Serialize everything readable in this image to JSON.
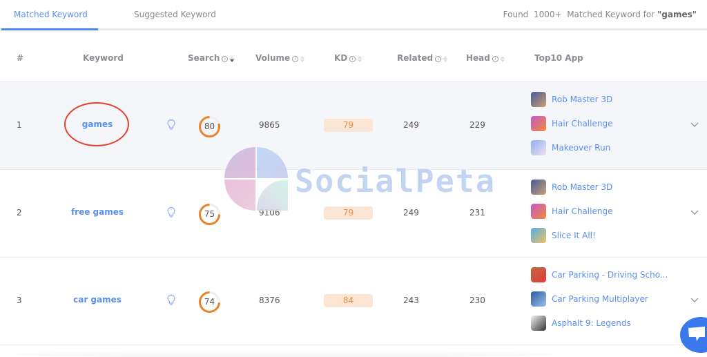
{
  "tabs": [
    {
      "label": "Matched Keyword",
      "active": true
    },
    {
      "label": "Suggested Keyword",
      "active": false
    }
  ],
  "found": {
    "prefix": "Found",
    "count": "1000+",
    "middle": "Matched Keyword for",
    "query": "\"games\""
  },
  "columns": {
    "rank": "#",
    "keyword": "Keyword",
    "search": "Search",
    "volume": "Volume",
    "kd": "KD",
    "related": "Related",
    "head": "Head",
    "top10": "Top10 App"
  },
  "sort": {
    "column": "Search",
    "direction": "descending"
  },
  "accent_colors": {
    "link": "#5b8ff0",
    "ring": "#e8832a",
    "kd_bg": "#fbe6d6",
    "kd_text": "#ed8a3d",
    "annotation": "#e0412c"
  },
  "rows": [
    {
      "rank": "1",
      "keyword": "games",
      "search": "80",
      "search_pct": 80,
      "volume": "9865",
      "kd": "79",
      "related": "249",
      "head": "229",
      "apps": [
        "Rob Master 3D",
        "Hair Challenge",
        "Makeover Run"
      ]
    },
    {
      "rank": "2",
      "keyword": "free games",
      "search": "75",
      "search_pct": 75,
      "volume": "9106",
      "kd": "79",
      "related": "249",
      "head": "231",
      "apps": [
        "Rob Master 3D",
        "Hair Challenge",
        "Slice It All!"
      ]
    },
    {
      "rank": "3",
      "keyword": "car games",
      "search": "74",
      "search_pct": 74,
      "volume": "8376",
      "kd": "84",
      "related": "243",
      "head": "230",
      "apps": [
        "Car Parking - Driving Scho...",
        "Car Parking Multiplayer",
        "Asphalt 9: Legends"
      ]
    }
  ],
  "watermark": "SocialPeta"
}
